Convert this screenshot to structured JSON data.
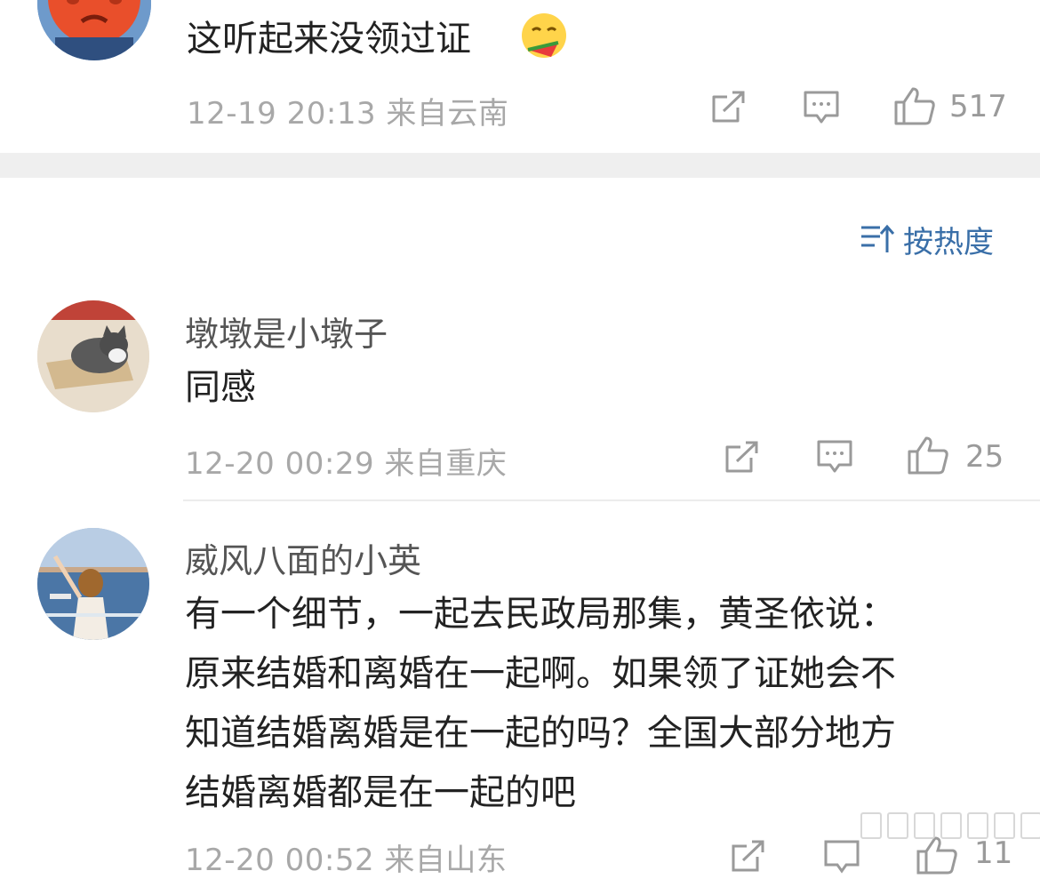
{
  "comments": [
    {
      "text": "这听起来没领过证",
      "meta": "12-19 20:13 来自云南",
      "likes": "517"
    },
    {
      "username": "墩墩是小墩子",
      "text": "同感",
      "meta": "12-20 00:29 来自重庆",
      "likes": "25"
    },
    {
      "username": "威风八面的小英",
      "lines": [
        "有一个细节，一起去民政局那集，黄圣依说：",
        "原来结婚和离婚在一起啊。如果领了证她会不",
        "知道结婚离婚是在一起的吗？全国大部分地方",
        "结婚离婚都是在一起的吧"
      ],
      "meta_partial": "12-20 00:52 来自山东",
      "likes_partial": "11"
    }
  ],
  "sort": {
    "label": "按热度"
  },
  "colors": {
    "accent": "#3a6fa8",
    "meta": "#a8a8a8",
    "gap": "#efefef"
  }
}
